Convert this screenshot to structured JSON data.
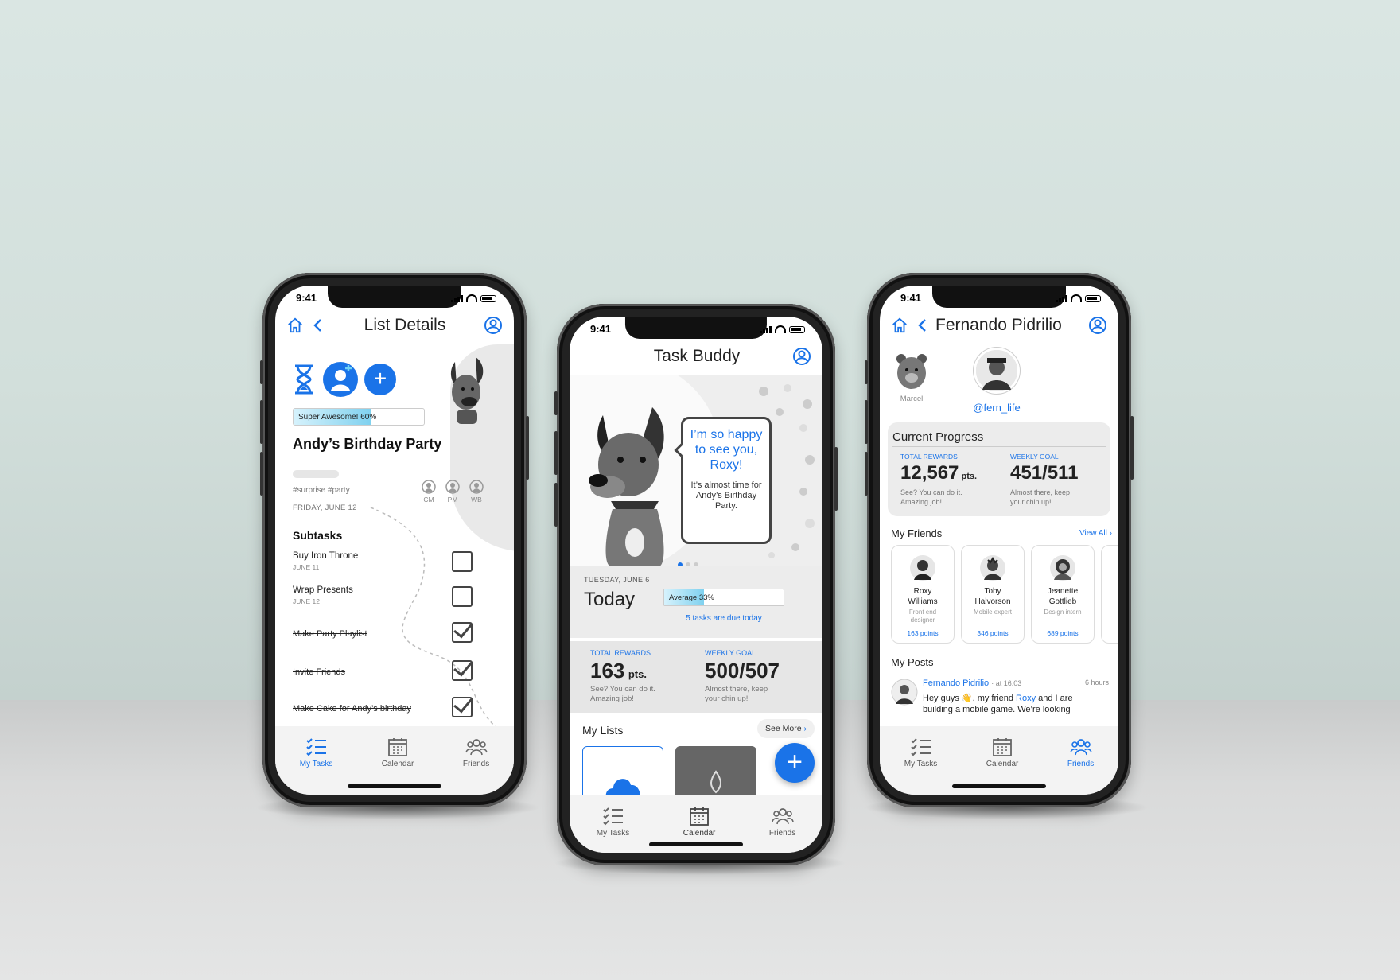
{
  "phone1": {
    "time": "9:41",
    "title": "List Details",
    "progress_label": "Super Awesome! 60%",
    "progress": 0.6,
    "list_name": "Andy’s Birthday Party",
    "tags": "#surprise #party",
    "date": "FRIDAY, JUNE 12",
    "members": [
      "CM",
      "PM",
      "WB"
    ],
    "subtasks_heading": "Subtasks",
    "subtasks": [
      {
        "name": "Buy Iron Throne",
        "date": "JUNE 11",
        "done": false
      },
      {
        "name": "Wrap Presents",
        "date": "JUNE 12",
        "done": false
      },
      {
        "name": "Make Party Playlist",
        "date": "",
        "done": true
      },
      {
        "name": "Invite Friends",
        "date": "",
        "done": true
      },
      {
        "name": "Make Cake for Andy’s birthday",
        "date": "",
        "done": true
      }
    ],
    "tabs": [
      "My Tasks",
      "Calendar",
      "Friends"
    ],
    "active_tab": "My Tasks"
  },
  "phone2": {
    "time": "9:41",
    "title": "Task Buddy",
    "bubble_main": "I’m so happy to see you, Roxy!",
    "bubble_sub": "It’s almost time for Andy’s Birthday Party.",
    "date": "TUESDAY, JUNE 6",
    "today": "Today",
    "progress_label": "Average 33%",
    "progress": 0.33,
    "due": "5 tasks are due today",
    "total_rewards_label": "TOTAL REWARDS",
    "total_rewards": "163",
    "pts": "pts.",
    "rewards_note": "See? You can do it. Amazing job!",
    "weekly_goal_label": "WEEKLY GOAL",
    "weekly_goal": "500/507",
    "goal_note": "Almost there, keep your chin up!",
    "my_lists": "My Lists",
    "see_more": "See More",
    "tabs": [
      "My Tasks",
      "Calendar",
      "Friends"
    ],
    "active_tab": "Calendar"
  },
  "phone3": {
    "time": "9:41",
    "title": "Fernando Pidrilio",
    "side_profile": "Marcel",
    "handle": "@fern_life",
    "progress_heading": "Current Progress",
    "total_rewards_label": "TOTAL REWARDS",
    "total_rewards": "12,567",
    "pts": "pts.",
    "rewards_note": "See? You can do it. Amazing job!",
    "weekly_goal_label": "WEEKLY GOAL",
    "weekly_goal": "451/511",
    "goal_note": "Almost there, keep your chin up!",
    "friends_heading": "My Friends",
    "view_all": "View All",
    "friends": [
      {
        "name": "Roxy Williams",
        "role": "Front end designer",
        "points": "163 points"
      },
      {
        "name": "Toby Halvorson",
        "role": "Mobile expert",
        "points": "346 points"
      },
      {
        "name": "Jeanette Gottlieb",
        "role": "Design intern",
        "points": "689 points"
      }
    ],
    "posts_heading": "My Posts",
    "post_author": "Fernando Pidrilio",
    "post_time": "· at 16:03",
    "post_age": "6 hours",
    "post_text_a": "Hey guys 👋, my friend",
    "post_mention": "Roxy",
    "post_text_b": "and I are",
    "post_text_c": "building a mobile game. We’re looking",
    "tabs": [
      "My Tasks",
      "Calendar",
      "Friends"
    ],
    "active_tab": "Friends"
  }
}
